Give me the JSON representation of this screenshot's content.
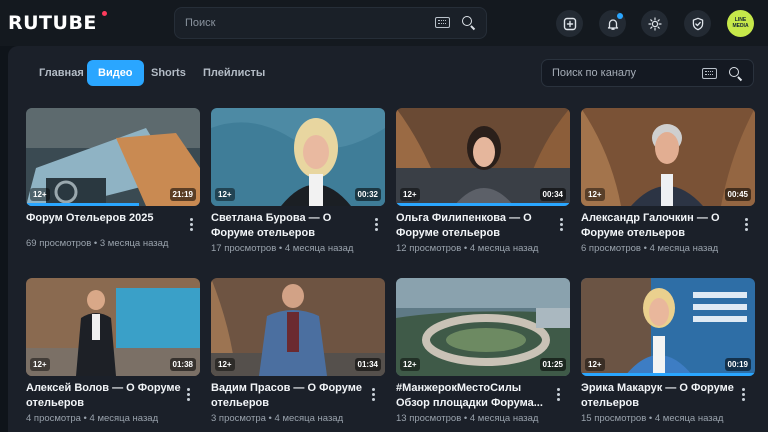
{
  "header": {
    "logo": "RUTUBE",
    "search_placeholder": "Поиск",
    "avatar_text": "LINE MEDIA"
  },
  "channel": {
    "tabs": [
      {
        "label": "Главная",
        "active": false
      },
      {
        "label": "Видео",
        "active": true
      },
      {
        "label": "Shorts",
        "active": false
      },
      {
        "label": "Плейлисты",
        "active": false
      }
    ],
    "search_placeholder": "Поиск по каналу"
  },
  "videos": [
    {
      "title": "Форум Отельеров 2025",
      "age": "12+",
      "duration": "21:19",
      "views": "69 просмотров",
      "date": "3 месяца назад",
      "progress": 0.65
    },
    {
      "title": "Светлана Бурова — О Форуме отельеров",
      "age": "12+",
      "duration": "00:32",
      "views": "17 просмотров",
      "date": "4 месяца назад",
      "progress": 0
    },
    {
      "title": "Ольга Филипенкова — О Форуме отельеров",
      "age": "12+",
      "duration": "00:34",
      "views": "12 просмотров",
      "date": "4 месяца назад",
      "progress": 1
    },
    {
      "title": "Александр Галочкин — О Форуме отельеров",
      "age": "12+",
      "duration": "00:45",
      "views": "6 просмотров",
      "date": "4 месяца назад",
      "progress": 0
    },
    {
      "title": "Алексей Волов — О Форуме отельеров",
      "age": "12+",
      "duration": "01:38",
      "views": "4 просмотра",
      "date": "4 месяца назад",
      "progress": 0
    },
    {
      "title": "Вадим Прасов — О Форуме отельеров",
      "age": "12+",
      "duration": "01:34",
      "views": "3 просмотра",
      "date": "4 месяца назад",
      "progress": 0
    },
    {
      "title": "#МанжерокМестоСилы Обзор площадки Форума...",
      "age": "12+",
      "duration": "01:25",
      "views": "13 просмотров",
      "date": "4 месяца назад",
      "progress": 0
    },
    {
      "title": "Эрика Макарук — О Форуме отельеров",
      "age": "12+",
      "duration": "00:19",
      "views": "15 просмотров",
      "date": "4 месяца назад",
      "progress": 1
    }
  ],
  "colors": {
    "accent": "#2aa6ff",
    "background": "#0f141a",
    "panel": "#1b2029"
  }
}
